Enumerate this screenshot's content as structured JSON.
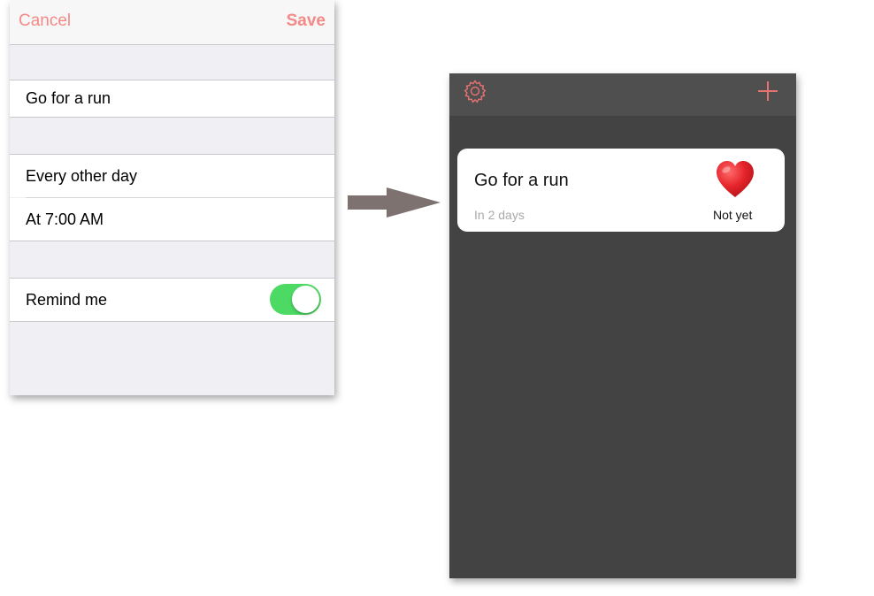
{
  "edit_screen": {
    "nav": {
      "cancel_label": "Cancel",
      "save_label": "Save"
    },
    "task_name": "Go for a run",
    "frequency": "Every other day",
    "time": "At 7:00 AM",
    "remind": {
      "label": "Remind me",
      "enabled": true
    }
  },
  "list_screen": {
    "nav": {
      "settings_icon": "gear-icon",
      "add_icon": "plus-icon"
    },
    "card": {
      "title": "Go for a run",
      "subtitle": "In 2 days",
      "status_icon": "heart-icon",
      "status": "Not yet"
    }
  },
  "colors": {
    "accent": "#f48a87",
    "toggle_on": "#4cd964",
    "list_bg": "#434343",
    "list_nav_bg": "#4f4f4f",
    "heart": "#e5242b",
    "arrow": "#7d7270"
  }
}
